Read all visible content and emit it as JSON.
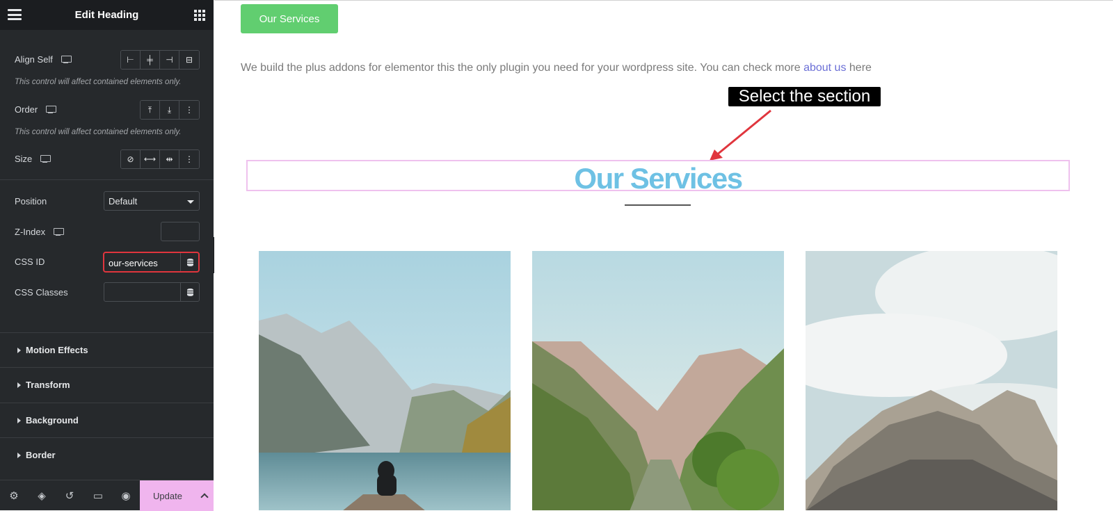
{
  "sidebar": {
    "title": "Edit Heading",
    "controls": {
      "align_self_label": "Align Self",
      "align_note": "This control will affect contained elements only.",
      "order_label": "Order",
      "order_note": "This control will affect contained elements only.",
      "size_label": "Size",
      "position_label": "Position",
      "position_value": "Default",
      "zindex_label": "Z-Index",
      "css_id_label": "CSS ID",
      "css_id_value": "our-services",
      "css_classes_label": "CSS Classes"
    },
    "sections": [
      "Motion Effects",
      "Transform",
      "Background",
      "Border"
    ],
    "footer": {
      "update_label": "Update"
    }
  },
  "canvas": {
    "button_label": "Our Services",
    "intro_text": "We build the plus addons for elementor this the only plugin you need for your wordpress site. You can check more ",
    "intro_link": "about us",
    "intro_suffix": " here",
    "callout": "Select the section",
    "heading": "Our Services",
    "images": [
      "lake-mountains-person",
      "mountain-valley",
      "misty-mountain-ridge"
    ]
  },
  "colors": {
    "sidebar_bg": "#26292c",
    "header_bg": "#1b1d20",
    "update_bg": "#f0b5ee",
    "highlight_border": "#e0353d",
    "green_button": "#61ce70",
    "heading_color": "#6ec1e4",
    "link_color": "#6b6fd6",
    "section_outline": "#efc1ee",
    "arrow": "#e0353d"
  }
}
